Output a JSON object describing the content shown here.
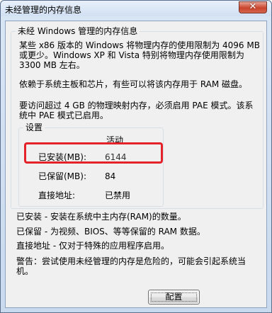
{
  "window": {
    "title": "未经管理的内存信息",
    "close_label": "✕"
  },
  "info_group": {
    "legend": "未经 Windows 管理的内存信息",
    "para1_line1": "某些 x86 版本的 Windows 将物理内存的使用限制为 4096 MB",
    "para1_line2": "或更少。Windows XP 和 Vista 特别将物理内存使用限制为",
    "para1_line3": "3300 MB 左右。",
    "para2": "依赖于系统主板和芯片，有些可以将该内存用于 RAM 磁盘。",
    "para3_line1": "要访问超过 4 GB 的物理映射内存，必须启用 PAE 模式。该系",
    "para3_line2": "统中 PAE 模式已启用。"
  },
  "settings_group": {
    "legend": "设置",
    "column_header": "活动",
    "rows": [
      {
        "label": "已安装(MB):",
        "value": "6144"
      },
      {
        "label": "已保留(MB):",
        "value": "84"
      },
      {
        "label": "直接地址:",
        "value": "已禁用"
      }
    ]
  },
  "descriptions": {
    "installed": "已安装 - 安装在系统中主内存(RAM)的数量。",
    "reserved": "已保留 - 为视频、BIOS、等等保留的 RAM 数据。",
    "direct": "直接地址 - 仅对于特殊的应用程序启用。",
    "warning_line1": "警告：尝试使用未经管理的内存是危险的，可能会引起系统当",
    "warning_line2": "机。"
  },
  "buttons": {
    "config_label": "配置"
  },
  "colors": {
    "highlight": "#e4222a",
    "frame": "#5c6f8c"
  }
}
